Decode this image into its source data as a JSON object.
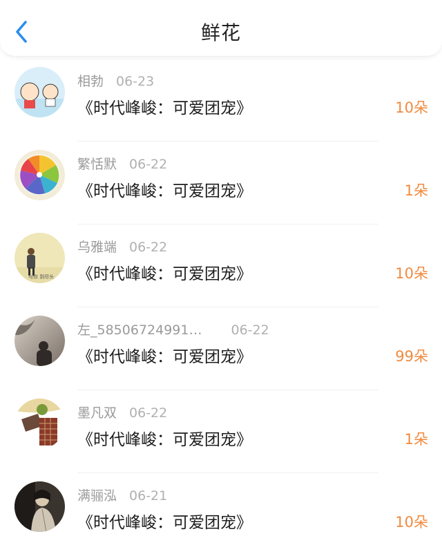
{
  "header": {
    "title": "鲜花",
    "back_icon": "chevron-left-icon",
    "accent_color": "#2a8dee"
  },
  "count_color": "#f08a3e",
  "items": [
    {
      "user": "相勃",
      "date": "06-23",
      "work": "《时代峰峻：可爱团宠》",
      "count": "10朵",
      "avatar": "cartoon-avatar"
    },
    {
      "user": "繁恬默",
      "date": "06-22",
      "work": "《时代峰峻：可爱团宠》",
      "count": "1朵",
      "avatar": "citrus-avatar"
    },
    {
      "user": "乌雅端",
      "date": "06-22",
      "work": "《时代峰峻：可爱团宠》",
      "count": "10朵",
      "avatar": "photo-avatar"
    },
    {
      "user": "左_58506724991…",
      "date": "06-22",
      "work": "《时代峰峻：可爱团宠》",
      "count": "99朵",
      "avatar": "shadow-avatar"
    },
    {
      "user": "墨凡双",
      "date": "06-22",
      "work": "《时代峰峻：可爱团宠》",
      "count": "1朵",
      "avatar": "plaid-avatar"
    },
    {
      "user": "满骊泓",
      "date": "06-21",
      "work": "《时代峰峻：可爱团宠》",
      "count": "10朵",
      "avatar": "portrait-avatar"
    }
  ]
}
